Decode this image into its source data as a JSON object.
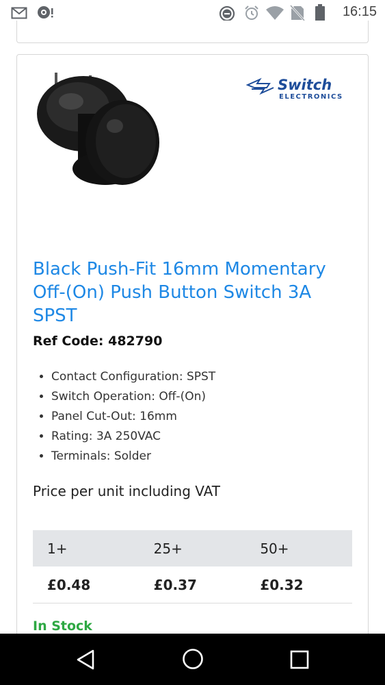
{
  "status_bar": {
    "time": "16:15",
    "icons": [
      "mail-icon",
      "camera-notification-icon",
      "do-not-disturb-icon",
      "alarm-icon",
      "wifi-icon",
      "no-sim-icon",
      "battery-icon"
    ]
  },
  "product": {
    "brand": {
      "name": "Switch",
      "subtitle": "ELECTRONICS"
    },
    "title": "Black Push-Fit 16mm Momentary Off-(On) Push Button Switch 3A SPST",
    "ref_code": "Ref Code: 482790",
    "specs": [
      "Contact Configuration: SPST",
      "Switch Operation: Off-(On)",
      "Panel Cut-Out: 16mm",
      "Rating: 3A 250VAC",
      "Terminals: Solder"
    ],
    "price_label": "Price per unit including VAT",
    "price_tiers": [
      {
        "qty": "1+",
        "price": "£0.48"
      },
      {
        "qty": "25+",
        "price": "£0.37"
      },
      {
        "qty": "50+",
        "price": "£0.32"
      }
    ],
    "stock_status": "In Stock"
  },
  "nav_bar": {
    "buttons": [
      "back-icon",
      "home-icon",
      "recents-icon"
    ]
  },
  "colors": {
    "title": "#1e88e5",
    "stock": "#2ea843",
    "table_header": "#e3e5e8"
  }
}
